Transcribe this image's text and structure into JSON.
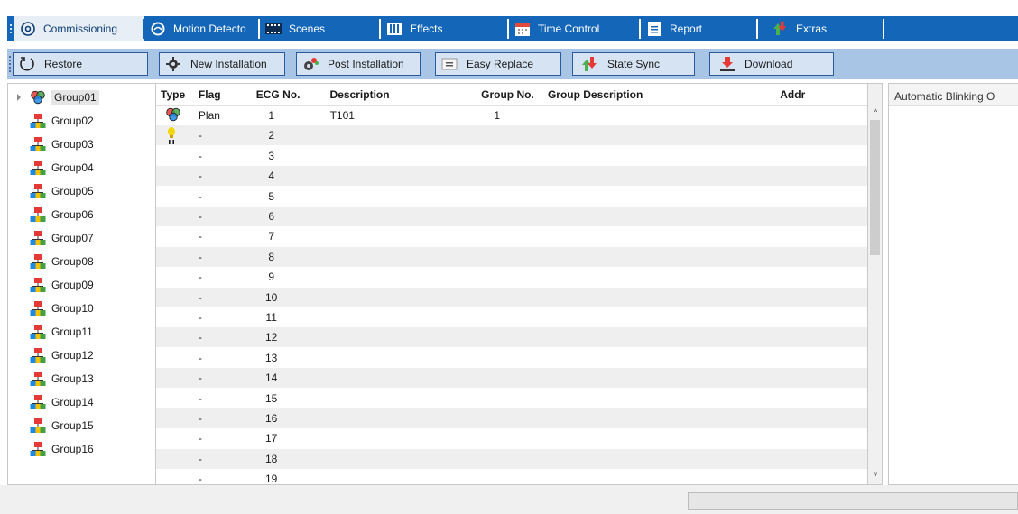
{
  "tabs": [
    {
      "label": "Commissioning",
      "icon": "target-icon",
      "active": true
    },
    {
      "label": "Motion Detecto",
      "icon": "motion-sensor-icon",
      "active": false
    },
    {
      "label": "Scenes",
      "icon": "scenes-film-icon",
      "active": false
    },
    {
      "label": "Effects",
      "icon": "effects-bars-icon",
      "active": false
    },
    {
      "label": "Time Control",
      "icon": "calendar-icon",
      "active": false
    },
    {
      "label": "Report",
      "icon": "report-icon",
      "active": false
    },
    {
      "label": "Extras",
      "icon": "extras-arrows-icon",
      "active": false
    }
  ],
  "toolbar": {
    "restore": "Restore",
    "new_installation": "New Installation",
    "post_installation": "Post Installation",
    "easy_replace": "Easy Replace",
    "state_sync": "State Sync",
    "download": "Download"
  },
  "tree": {
    "items": [
      {
        "label": "Group01",
        "selected": true,
        "icon": "group-circles-icon"
      },
      {
        "label": "Group02",
        "icon": "group-network-icon"
      },
      {
        "label": "Group03",
        "icon": "group-network-icon"
      },
      {
        "label": "Group04",
        "icon": "group-network-icon"
      },
      {
        "label": "Group05",
        "icon": "group-network-icon"
      },
      {
        "label": "Group06",
        "icon": "group-network-icon"
      },
      {
        "label": "Group07",
        "icon": "group-network-icon"
      },
      {
        "label": "Group08",
        "icon": "group-network-icon"
      },
      {
        "label": "Group09",
        "icon": "group-network-icon"
      },
      {
        "label": "Group10",
        "icon": "group-network-icon"
      },
      {
        "label": "Group11",
        "icon": "group-network-icon"
      },
      {
        "label": "Group12",
        "icon": "group-network-icon"
      },
      {
        "label": "Group13",
        "icon": "group-network-icon"
      },
      {
        "label": "Group14",
        "icon": "group-network-icon"
      },
      {
        "label": "Group15",
        "icon": "group-network-icon"
      },
      {
        "label": "Group16",
        "icon": "group-network-icon"
      }
    ]
  },
  "grid": {
    "columns": {
      "type": "Type",
      "flag": "Flag",
      "ecg": "ECG No.",
      "description": "Description",
      "group_no": "Group No.",
      "group_description": "Group Description",
      "addr": "Addr"
    },
    "rows": [
      {
        "type_icon": "group-circles-icon",
        "flag": "Plan",
        "ecg": "1",
        "description": "T101",
        "group_no": "1",
        "group_description": "",
        "addr": ""
      },
      {
        "type_icon": "lamp-icon",
        "flag": "-",
        "ecg": "2",
        "description": "",
        "group_no": "",
        "group_description": "",
        "addr": ""
      },
      {
        "flag": "-",
        "ecg": "3",
        "description": "",
        "group_no": "",
        "group_description": "",
        "addr": ""
      },
      {
        "flag": "-",
        "ecg": "4",
        "description": "",
        "group_no": "",
        "group_description": "",
        "addr": ""
      },
      {
        "flag": "-",
        "ecg": "5",
        "description": "",
        "group_no": "",
        "group_description": "",
        "addr": ""
      },
      {
        "flag": "-",
        "ecg": "6",
        "description": "",
        "group_no": "",
        "group_description": "",
        "addr": ""
      },
      {
        "flag": "-",
        "ecg": "7",
        "description": "",
        "group_no": "",
        "group_description": "",
        "addr": ""
      },
      {
        "flag": "-",
        "ecg": "8",
        "description": "",
        "group_no": "",
        "group_description": "",
        "addr": ""
      },
      {
        "flag": "-",
        "ecg": "9",
        "description": "",
        "group_no": "",
        "group_description": "",
        "addr": ""
      },
      {
        "flag": "-",
        "ecg": "10",
        "description": "",
        "group_no": "",
        "group_description": "",
        "addr": ""
      },
      {
        "flag": "-",
        "ecg": "11",
        "description": "",
        "group_no": "",
        "group_description": "",
        "addr": ""
      },
      {
        "flag": "-",
        "ecg": "12",
        "description": "",
        "group_no": "",
        "group_description": "",
        "addr": ""
      },
      {
        "flag": "-",
        "ecg": "13",
        "description": "",
        "group_no": "",
        "group_description": "",
        "addr": ""
      },
      {
        "flag": "-",
        "ecg": "14",
        "description": "",
        "group_no": "",
        "group_description": "",
        "addr": ""
      },
      {
        "flag": "-",
        "ecg": "15",
        "description": "",
        "group_no": "",
        "group_description": "",
        "addr": ""
      },
      {
        "flag": "-",
        "ecg": "16",
        "description": "",
        "group_no": "",
        "group_description": "",
        "addr": ""
      },
      {
        "flag": "-",
        "ecg": "17",
        "description": "",
        "group_no": "",
        "group_description": "",
        "addr": ""
      },
      {
        "flag": "-",
        "ecg": "18",
        "description": "",
        "group_no": "",
        "group_description": "",
        "addr": ""
      },
      {
        "flag": "-",
        "ecg": "19",
        "description": "",
        "group_no": "",
        "group_description": "",
        "addr": ""
      }
    ]
  },
  "right_panel": {
    "header": "Automatic Blinking O"
  },
  "colors": {
    "tabbar": "#1466b8",
    "toolbar": "#a9c5e6",
    "button_border": "#2c5aa0"
  }
}
